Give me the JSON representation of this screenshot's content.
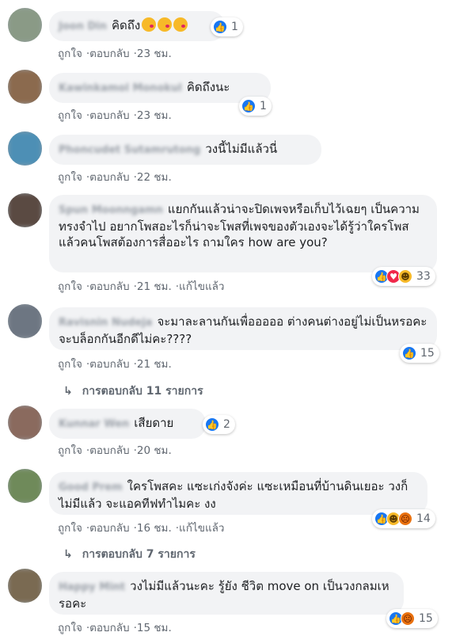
{
  "action_labels": {
    "like": "ถูกใจ",
    "reply": "ตอบกลับ",
    "edited": "แก้ไขแล้ว",
    "sep": "·"
  },
  "colors": {
    "bubble": "#f2f3f5",
    "like": "#1877f2",
    "love": "#f0284a",
    "haha": "#f7b928",
    "angry": "#e9710f",
    "meta": "#606770"
  },
  "comments": [
    {
      "name": "Joon Din",
      "text": "คิดถึง",
      "emoji": "kissing-heart-emoji x3",
      "reactions": [
        "like"
      ],
      "count": "1",
      "time": "23 ชม.",
      "edited": false
    },
    {
      "name": "Kawinkamol Monokul",
      "text": "คิดถึงนะ",
      "reactions": [
        "like"
      ],
      "count": "1",
      "time": "23 ชม.",
      "edited": false
    },
    {
      "name": "Phoncudet Sutamrutong",
      "text": "วงนี้ไม่มีแล้วนี่",
      "reactions": [],
      "count": "",
      "time": "22 ชม.",
      "edited": false
    },
    {
      "name": "Spun Moonngamn",
      "text": "แยกกันแล้วน่าจะปิดเพจหรือเก็บไว้เฉยๆ เป็นความทรงจำไป อยากโพสอะไรก็น่าจะโพสที่เพจของตัวเองจะได้รู้ว่าใครโพสแล้วคนโพสต้องการสื่ออะไร ถามใคร how are you?",
      "reactions": [
        "like",
        "love",
        "haha"
      ],
      "count": "33",
      "time": "21 ชม.",
      "edited": true
    },
    {
      "name": "Ravisnin Nudeja",
      "text": "จะมาละลานกันเพื่อออออ ต่างคนต่างอยู่ไม่เป็นหรอคะ จะบล็อกกันอีกดีไม่คะ????",
      "reactions": [
        "like"
      ],
      "count": "15",
      "time": "21 ชม.",
      "edited": false,
      "replies": "การตอบกลับ 11 รายการ"
    },
    {
      "name": "Kunnar Wen",
      "text": "เสียดาย",
      "reactions": [
        "like"
      ],
      "count": "2",
      "time": "20 ชม.",
      "edited": false
    },
    {
      "name": "Good Prem",
      "text": "ใครโพสคะ แซะเก่งจังค่ะ แซะเหมือนที่บ้านดินเยอะ วงก็ไม่มีแล้ว จะแอคทีฟทำไมคะ งง",
      "reactions": [
        "like",
        "haha",
        "angry"
      ],
      "count": "14",
      "time": "16 ชม.",
      "edited": true,
      "replies": "การตอบกลับ 7 รายการ"
    },
    {
      "name": "Happy Mint",
      "text": "วงไม่มีแล้วนะคะ รู้ยัง ชีวิต move on เป็นวงกลมเหรอคะ",
      "reactions": [
        "like",
        "angry"
      ],
      "count": "15",
      "time": "15 ชม.",
      "edited": false
    }
  ]
}
